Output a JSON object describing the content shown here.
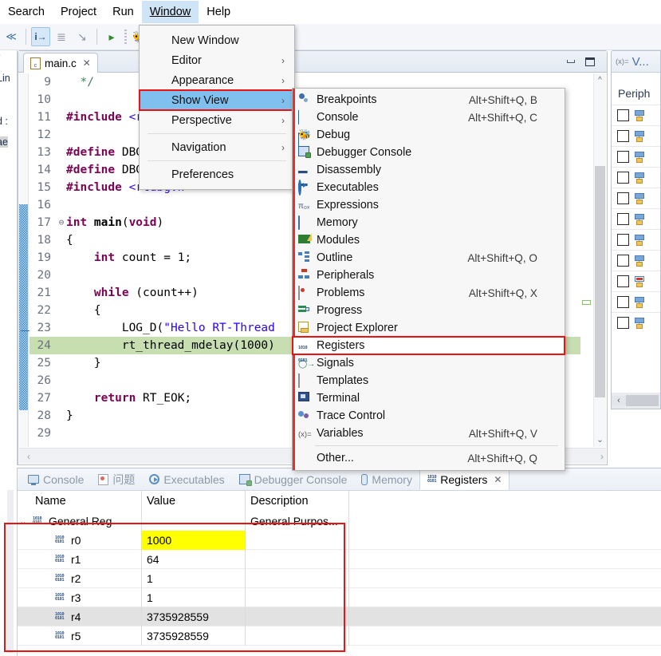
{
  "app": {
    "title": "Eclipse C/C++ IDE - main.c",
    "accent_highlight": "#7fc0ef",
    "red_annotation": "#ee1111",
    "yellow_cell": "#ffff00",
    "exec_line_highlight": "#c7dfb0"
  },
  "menubar": {
    "items": [
      {
        "label": "Search",
        "mnemonic": "a",
        "active": false
      },
      {
        "label": "Project",
        "mnemonic": "P",
        "active": false
      },
      {
        "label": "Run",
        "mnemonic": "R",
        "active": false
      },
      {
        "label": "Window",
        "mnemonic": "W",
        "active": true
      },
      {
        "label": "Help",
        "mnemonic": "H",
        "active": false
      }
    ]
  },
  "toolbar": {
    "buttons": [
      {
        "name": "skip-breakpoints-icon",
        "glyph": "i→",
        "selected": true
      },
      {
        "name": "step-into-selection-icon",
        "glyph": "⇥",
        "selected": false
      },
      {
        "name": "step-return-icon",
        "glyph": "⤴",
        "selected": false
      },
      {
        "name": "run-icon",
        "glyph": "▶",
        "selected": false
      },
      {
        "name": "debug-icon",
        "glyph": "☸",
        "selected": false
      },
      {
        "name": "open-resource-icon",
        "glyph": "📁",
        "selected": false
      }
    ]
  },
  "left_strip": {
    "fragments": [
      "Lin",
      "d :",
      "ae"
    ]
  },
  "editor": {
    "tab": {
      "label": "main.c",
      "close": "✕",
      "file_icon": "c-file-icon"
    },
    "minimize_tooltip": "Minimize",
    "maximize_tooltip": "Maximize",
    "lines": [
      {
        "num": "9",
        "fold": "",
        "highlight": false,
        "tokens": [
          {
            "t": "  ",
            "c": "plain"
          },
          {
            "t": "*/",
            "c": "cmt"
          }
        ]
      },
      {
        "num": "10",
        "fold": "",
        "highlight": false,
        "tokens": []
      },
      {
        "num": "11",
        "fold": "",
        "highlight": false,
        "tokens": [
          {
            "t": "#include ",
            "c": "pre"
          },
          {
            "t": "<r",
            "c": "inc"
          }
        ]
      },
      {
        "num": "12",
        "fold": "",
        "highlight": false,
        "tokens": []
      },
      {
        "num": "13",
        "fold": "",
        "highlight": false,
        "tokens": [
          {
            "t": "#define ",
            "c": "pre"
          },
          {
            "t": "DBG",
            "c": "plain"
          }
        ]
      },
      {
        "num": "14",
        "fold": "",
        "highlight": false,
        "tokens": [
          {
            "t": "#define ",
            "c": "pre"
          },
          {
            "t": "DBG",
            "c": "plain"
          }
        ]
      },
      {
        "num": "15",
        "fold": "",
        "highlight": false,
        "tokens": [
          {
            "t": "#include ",
            "c": "pre"
          },
          {
            "t": "<rtdbg.h>",
            "c": "inc"
          }
        ]
      },
      {
        "num": "16",
        "fold": "",
        "highlight": false,
        "tokens": []
      },
      {
        "num": "17",
        "fold": "⊖",
        "highlight": false,
        "tokens": [
          {
            "t": "int ",
            "c": "kw"
          },
          {
            "t": "main",
            "c": "fn"
          },
          {
            "t": "(",
            "c": "plain"
          },
          {
            "t": "void",
            "c": "kw"
          },
          {
            "t": ")",
            "c": "plain"
          }
        ]
      },
      {
        "num": "18",
        "fold": "",
        "highlight": false,
        "tokens": [
          {
            "t": "{",
            "c": "plain"
          }
        ]
      },
      {
        "num": "19",
        "fold": "",
        "highlight": false,
        "tokens": [
          {
            "t": "    ",
            "c": "plain"
          },
          {
            "t": "int",
            "c": "kw"
          },
          {
            "t": " count = 1;",
            "c": "plain"
          }
        ]
      },
      {
        "num": "20",
        "fold": "",
        "highlight": false,
        "tokens": []
      },
      {
        "num": "21",
        "fold": "",
        "highlight": false,
        "tokens": [
          {
            "t": "    ",
            "c": "plain"
          },
          {
            "t": "while",
            "c": "kw"
          },
          {
            "t": " (count++)",
            "c": "plain"
          }
        ]
      },
      {
        "num": "22",
        "fold": "",
        "highlight": false,
        "tokens": [
          {
            "t": "    {",
            "c": "plain"
          }
        ]
      },
      {
        "num": "23",
        "fold": "",
        "highlight": false,
        "tokens": [
          {
            "t": "        LOG_D(",
            "c": "plain"
          },
          {
            "t": "\"Hello RT-Thread",
            "c": "str"
          }
        ]
      },
      {
        "num": "24",
        "fold": "",
        "highlight": true,
        "tokens": [
          {
            "t": "        rt_thread_mdelay(1000)",
            "c": "plain"
          }
        ]
      },
      {
        "num": "25",
        "fold": "",
        "highlight": false,
        "tokens": [
          {
            "t": "    }",
            "c": "plain"
          }
        ]
      },
      {
        "num": "26",
        "fold": "",
        "highlight": false,
        "tokens": []
      },
      {
        "num": "27",
        "fold": "",
        "highlight": false,
        "tokens": [
          {
            "t": "    ",
            "c": "plain"
          },
          {
            "t": "return",
            "c": "kw"
          },
          {
            "t": " RT_EOK;",
            "c": "plain"
          }
        ]
      },
      {
        "num": "28",
        "fold": "",
        "highlight": false,
        "tokens": [
          {
            "t": "}",
            "c": "plain"
          }
        ]
      },
      {
        "num": "29",
        "fold": "",
        "highlight": false,
        "tokens": []
      }
    ]
  },
  "window_menu": {
    "items": [
      {
        "label": "New Window",
        "submenu": false,
        "highlighted": false
      },
      {
        "label": "Editor",
        "submenu": true,
        "highlighted": false
      },
      {
        "label": "Appearance",
        "submenu": true,
        "highlighted": false
      },
      {
        "label": "Show View",
        "submenu": true,
        "highlighted": true
      },
      {
        "label": "Perspective",
        "submenu": true,
        "highlighted": false
      },
      {
        "separator_after": true,
        "label": "Navigation",
        "submenu": true,
        "highlighted": false
      },
      {
        "label": "Preferences",
        "submenu": false,
        "highlighted": false
      }
    ],
    "arrow_glyph": "›"
  },
  "show_view_menu": {
    "items": [
      {
        "label": "Breakpoints",
        "shortcut": "Alt+Shift+Q, B",
        "icon": "breakpoints-icon",
        "highlighted": false
      },
      {
        "label": "Console",
        "shortcut": "Alt+Shift+Q, C",
        "icon": "console-icon",
        "highlighted": false
      },
      {
        "label": "Debug",
        "shortcut": "",
        "icon": "debug-bug-icon",
        "highlighted": false
      },
      {
        "label": "Debugger Console",
        "shortcut": "",
        "icon": "debugger-console-icon",
        "highlighted": false
      },
      {
        "label": "Disassembly",
        "shortcut": "",
        "icon": "disassembly-icon",
        "highlighted": false
      },
      {
        "label": "Executables",
        "shortcut": "",
        "icon": "executables-icon",
        "highlighted": false
      },
      {
        "label": "Expressions",
        "shortcut": "",
        "icon": "expressions-icon",
        "highlighted": false
      },
      {
        "label": "Memory",
        "shortcut": "",
        "icon": "memory-icon",
        "highlighted": false
      },
      {
        "label": "Modules",
        "shortcut": "",
        "icon": "modules-icon",
        "highlighted": false
      },
      {
        "label": "Outline",
        "shortcut": "Alt+Shift+Q, O",
        "icon": "outline-icon",
        "highlighted": false
      },
      {
        "label": "Peripherals",
        "shortcut": "",
        "icon": "peripherals-icon",
        "highlighted": false
      },
      {
        "label": "Problems",
        "shortcut": "Alt+Shift+Q, X",
        "icon": "problems-icon",
        "highlighted": false
      },
      {
        "label": "Progress",
        "shortcut": "",
        "icon": "progress-icon",
        "highlighted": false
      },
      {
        "label": "Project Explorer",
        "shortcut": "",
        "icon": "project-explorer-icon",
        "highlighted": false
      },
      {
        "label": "Registers",
        "shortcut": "",
        "icon": "registers-icon",
        "highlighted": true
      },
      {
        "label": "Signals",
        "shortcut": "",
        "icon": "signals-icon",
        "highlighted": false
      },
      {
        "label": "Templates",
        "shortcut": "",
        "icon": "templates-icon",
        "highlighted": false
      },
      {
        "label": "Terminal",
        "shortcut": "",
        "icon": "terminal-icon",
        "highlighted": false
      },
      {
        "label": "Trace Control",
        "shortcut": "",
        "icon": "trace-control-icon",
        "highlighted": false
      },
      {
        "label": "Variables",
        "shortcut": "Alt+Shift+Q, V",
        "icon": "variables-icon",
        "highlighted": false
      },
      {
        "separator_before": true,
        "label": "Other...",
        "shortcut": "Alt+Shift+Q, Q",
        "icon": "",
        "highlighted": false
      }
    ]
  },
  "right_panel": {
    "tab": {
      "prefix": "(x)=",
      "label": "V..."
    },
    "title": "Periph",
    "rows": [
      {
        "checked": false,
        "state": "normal"
      },
      {
        "checked": false,
        "state": "normal"
      },
      {
        "checked": false,
        "state": "normal"
      },
      {
        "checked": false,
        "state": "normal"
      },
      {
        "checked": false,
        "state": "normal"
      },
      {
        "checked": false,
        "state": "normal"
      },
      {
        "checked": false,
        "state": "normal"
      },
      {
        "checked": false,
        "state": "normal"
      },
      {
        "checked": false,
        "state": "red"
      },
      {
        "checked": false,
        "state": "normal"
      },
      {
        "checked": false,
        "state": "normal"
      }
    ],
    "scroll_left_glyph": "‹"
  },
  "bottom_panel": {
    "tabs": [
      {
        "label": "Console",
        "icon": "console-icon",
        "active": false,
        "close": false
      },
      {
        "label": "问题",
        "icon": "problems-icon",
        "active": false,
        "close": false
      },
      {
        "label": "Executables",
        "icon": "executables-icon",
        "active": false,
        "close": false
      },
      {
        "label": "Debugger Console",
        "icon": "debugger-console-icon",
        "active": false,
        "close": false
      },
      {
        "label": "Memory",
        "icon": "memory-icon",
        "active": false,
        "close": false
      },
      {
        "label": "Registers",
        "icon": "registers-icon",
        "active": true,
        "close": true,
        "close_glyph": "✕"
      }
    ],
    "registers": {
      "columns": [
        "Name",
        "Value",
        "Description"
      ],
      "group": {
        "name": "General Reg",
        "description": "General Purpos...",
        "expanded": true,
        "twisty": "⌄"
      },
      "rows": [
        {
          "name": "r0",
          "value": "1000",
          "description": "",
          "highlight_value": true,
          "alt_row": false
        },
        {
          "name": "r1",
          "value": "64",
          "description": "",
          "highlight_value": false,
          "alt_row": false
        },
        {
          "name": "r2",
          "value": "1",
          "description": "",
          "highlight_value": false,
          "alt_row": false
        },
        {
          "name": "r3",
          "value": "1",
          "description": "",
          "highlight_value": false,
          "alt_row": false
        },
        {
          "name": "r4",
          "value": "3735928559",
          "description": "",
          "highlight_value": false,
          "alt_row": true
        },
        {
          "name": "r5",
          "value": "3735928559",
          "description": "",
          "highlight_value": false,
          "alt_row": false
        }
      ]
    }
  }
}
